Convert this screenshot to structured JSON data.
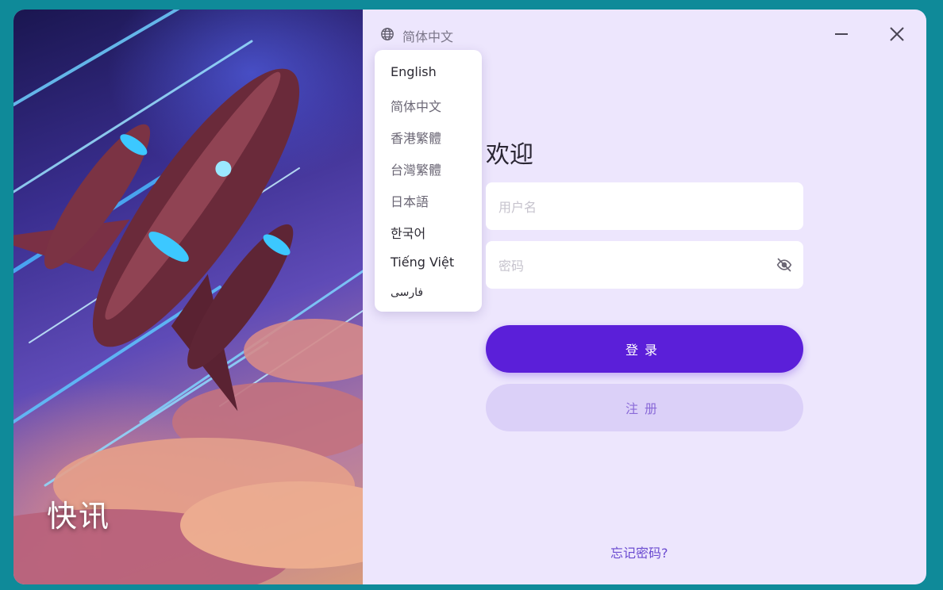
{
  "brand": {
    "name": "快讯"
  },
  "language": {
    "current": "简体中文",
    "options": [
      "English",
      "简体中文",
      "香港繁體",
      "台灣繁體",
      "日本語",
      "한국어",
      "Tiếng Việt",
      "فارسی"
    ]
  },
  "form": {
    "title": "欢迎",
    "username_placeholder": "用户名",
    "password_placeholder": "密码",
    "login_label": "登录",
    "register_label": "注册",
    "forgot_label": "忘记密码?"
  },
  "colors": {
    "accent": "#5b1fd9",
    "panel_bg": "#ede6fd",
    "secondary_button": "#dbd0f8",
    "window_bg": "#0f8a99"
  },
  "icons": {
    "language": "globe-icon",
    "minimize": "minimize-icon",
    "close": "close-icon",
    "password_toggle": "eye-off-icon"
  }
}
